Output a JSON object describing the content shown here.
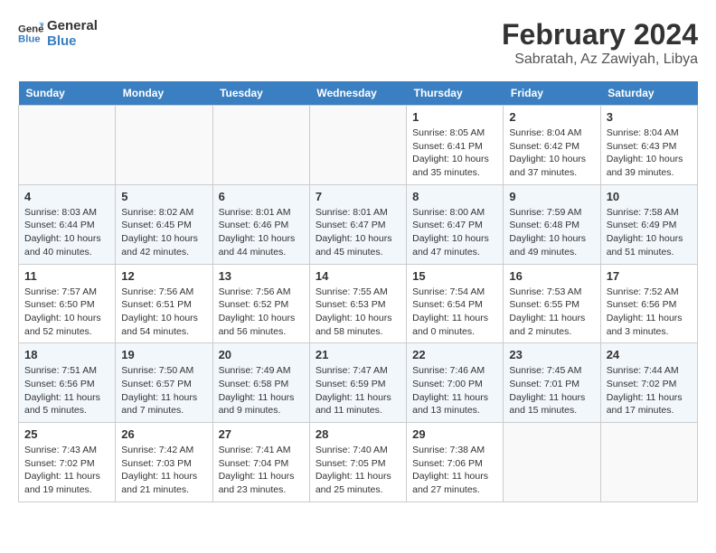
{
  "header": {
    "logo_line1": "General",
    "logo_line2": "Blue",
    "month": "February 2024",
    "location": "Sabratah, Az Zawiyah, Libya"
  },
  "weekdays": [
    "Sunday",
    "Monday",
    "Tuesday",
    "Wednesday",
    "Thursday",
    "Friday",
    "Saturday"
  ],
  "weeks": [
    [
      {
        "day": "",
        "info": ""
      },
      {
        "day": "",
        "info": ""
      },
      {
        "day": "",
        "info": ""
      },
      {
        "day": "",
        "info": ""
      },
      {
        "day": "1",
        "info": "Sunrise: 8:05 AM\nSunset: 6:41 PM\nDaylight: 10 hours\nand 35 minutes."
      },
      {
        "day": "2",
        "info": "Sunrise: 8:04 AM\nSunset: 6:42 PM\nDaylight: 10 hours\nand 37 minutes."
      },
      {
        "day": "3",
        "info": "Sunrise: 8:04 AM\nSunset: 6:43 PM\nDaylight: 10 hours\nand 39 minutes."
      }
    ],
    [
      {
        "day": "4",
        "info": "Sunrise: 8:03 AM\nSunset: 6:44 PM\nDaylight: 10 hours\nand 40 minutes."
      },
      {
        "day": "5",
        "info": "Sunrise: 8:02 AM\nSunset: 6:45 PM\nDaylight: 10 hours\nand 42 minutes."
      },
      {
        "day": "6",
        "info": "Sunrise: 8:01 AM\nSunset: 6:46 PM\nDaylight: 10 hours\nand 44 minutes."
      },
      {
        "day": "7",
        "info": "Sunrise: 8:01 AM\nSunset: 6:47 PM\nDaylight: 10 hours\nand 45 minutes."
      },
      {
        "day": "8",
        "info": "Sunrise: 8:00 AM\nSunset: 6:47 PM\nDaylight: 10 hours\nand 47 minutes."
      },
      {
        "day": "9",
        "info": "Sunrise: 7:59 AM\nSunset: 6:48 PM\nDaylight: 10 hours\nand 49 minutes."
      },
      {
        "day": "10",
        "info": "Sunrise: 7:58 AM\nSunset: 6:49 PM\nDaylight: 10 hours\nand 51 minutes."
      }
    ],
    [
      {
        "day": "11",
        "info": "Sunrise: 7:57 AM\nSunset: 6:50 PM\nDaylight: 10 hours\nand 52 minutes."
      },
      {
        "day": "12",
        "info": "Sunrise: 7:56 AM\nSunset: 6:51 PM\nDaylight: 10 hours\nand 54 minutes."
      },
      {
        "day": "13",
        "info": "Sunrise: 7:56 AM\nSunset: 6:52 PM\nDaylight: 10 hours\nand 56 minutes."
      },
      {
        "day": "14",
        "info": "Sunrise: 7:55 AM\nSunset: 6:53 PM\nDaylight: 10 hours\nand 58 minutes."
      },
      {
        "day": "15",
        "info": "Sunrise: 7:54 AM\nSunset: 6:54 PM\nDaylight: 11 hours\nand 0 minutes."
      },
      {
        "day": "16",
        "info": "Sunrise: 7:53 AM\nSunset: 6:55 PM\nDaylight: 11 hours\nand 2 minutes."
      },
      {
        "day": "17",
        "info": "Sunrise: 7:52 AM\nSunset: 6:56 PM\nDaylight: 11 hours\nand 3 minutes."
      }
    ],
    [
      {
        "day": "18",
        "info": "Sunrise: 7:51 AM\nSunset: 6:56 PM\nDaylight: 11 hours\nand 5 minutes."
      },
      {
        "day": "19",
        "info": "Sunrise: 7:50 AM\nSunset: 6:57 PM\nDaylight: 11 hours\nand 7 minutes."
      },
      {
        "day": "20",
        "info": "Sunrise: 7:49 AM\nSunset: 6:58 PM\nDaylight: 11 hours\nand 9 minutes."
      },
      {
        "day": "21",
        "info": "Sunrise: 7:47 AM\nSunset: 6:59 PM\nDaylight: 11 hours\nand 11 minutes."
      },
      {
        "day": "22",
        "info": "Sunrise: 7:46 AM\nSunset: 7:00 PM\nDaylight: 11 hours\nand 13 minutes."
      },
      {
        "day": "23",
        "info": "Sunrise: 7:45 AM\nSunset: 7:01 PM\nDaylight: 11 hours\nand 15 minutes."
      },
      {
        "day": "24",
        "info": "Sunrise: 7:44 AM\nSunset: 7:02 PM\nDaylight: 11 hours\nand 17 minutes."
      }
    ],
    [
      {
        "day": "25",
        "info": "Sunrise: 7:43 AM\nSunset: 7:02 PM\nDaylight: 11 hours\nand 19 minutes."
      },
      {
        "day": "26",
        "info": "Sunrise: 7:42 AM\nSunset: 7:03 PM\nDaylight: 11 hours\nand 21 minutes."
      },
      {
        "day": "27",
        "info": "Sunrise: 7:41 AM\nSunset: 7:04 PM\nDaylight: 11 hours\nand 23 minutes."
      },
      {
        "day": "28",
        "info": "Sunrise: 7:40 AM\nSunset: 7:05 PM\nDaylight: 11 hours\nand 25 minutes."
      },
      {
        "day": "29",
        "info": "Sunrise: 7:38 AM\nSunset: 7:06 PM\nDaylight: 11 hours\nand 27 minutes."
      },
      {
        "day": "",
        "info": ""
      },
      {
        "day": "",
        "info": ""
      }
    ]
  ]
}
